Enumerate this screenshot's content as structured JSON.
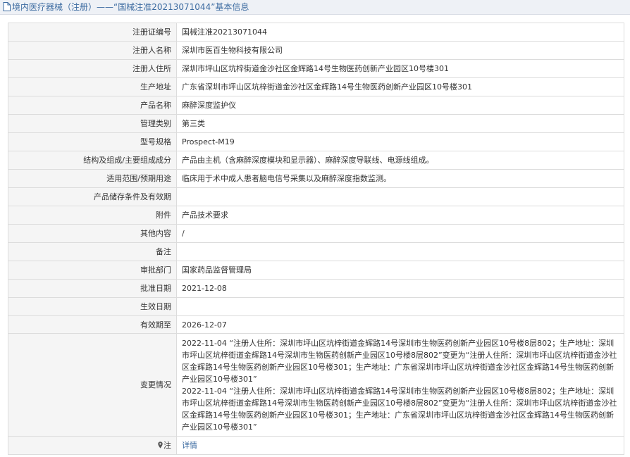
{
  "breadcrumb": {
    "icon": "document-icon",
    "text": "境内医疗器械（注册）——“国械注准20213071044”基本信息"
  },
  "rows": [
    {
      "label": "注册证编号",
      "value": "国械注准20213071044"
    },
    {
      "label": "注册人名称",
      "value": "深圳市医百生物科技有限公司"
    },
    {
      "label": "注册人住所",
      "value": "深圳市坪山区坑梓街道金沙社区金辉路14号生物医药创新产业园区10号楼301"
    },
    {
      "label": "生产地址",
      "value": "广东省深圳市坪山区坑梓街道金沙社区金辉路14号生物医药创新产业园区10号楼301"
    },
    {
      "label": "产品名称",
      "value": "麻醉深度监护仪"
    },
    {
      "label": "管理类别",
      "value": "第三类"
    },
    {
      "label": "型号规格",
      "value": "Prospect-M19"
    },
    {
      "label": "结构及组成/主要组成成分",
      "value": "产品由主机（含麻醉深度模块和显示器）、麻醉深度导联线、电源线组成。"
    },
    {
      "label": "适用范围/预期用途",
      "value": "临床用于术中成人患者脑电信号采集以及麻醉深度指数监测。"
    },
    {
      "label": "产品储存条件及有效期",
      "value": ""
    },
    {
      "label": "附件",
      "value": "产品技术要求"
    },
    {
      "label": "其他内容",
      "value": "/"
    },
    {
      "label": "备注",
      "value": ""
    },
    {
      "label": "审批部门",
      "value": "国家药品监督管理局"
    },
    {
      "label": "批准日期",
      "value": "2021-12-08"
    },
    {
      "label": "生效日期",
      "value": ""
    },
    {
      "label": "有效期至",
      "value": "2026-12-07"
    }
  ],
  "changes": {
    "label": "变更情况",
    "entries": [
      "2022-11-04 “注册人住所：深圳市坪山区坑梓街道金辉路14号深圳市生物医药创新产业园区10号楼8层802；生产地址：深圳市坪山区坑梓街道金辉路14号深圳市生物医药创新产业园区10号楼8层802”变更为“注册人住所：深圳市坪山区坑梓街道金沙社区金辉路14号生物医药创新产业园区10号楼301；生产地址：广东省深圳市坪山区坑梓街道金沙社区金辉路14号生物医药创新产业园区10号楼301”",
      "2022-11-04 “注册人住所：深圳市坪山区坑梓街道金辉路14号深圳市生物医药创新产业园区10号楼8层802；生产地址：深圳市坪山区坑梓街道金辉路14号深圳市生物医药创新产业园区10号楼8层802”变更为“注册人住所：深圳市坪山区坑梓街道金沙社区金辉路14号生物医药创新产业园区10号楼301；生产地址：广东省深圳市坪山区坑梓街道金沙社区金辉路14号生物医药创新产业园区10号楼301”"
    ]
  },
  "note": {
    "icon": "map-pin-icon",
    "label": "注",
    "link_text": "详情"
  },
  "colors": {
    "link": "#3b6aa0",
    "label_bg": "#f5f5f5",
    "border": "#dcdcdc",
    "header_bg": "#eef1f6"
  }
}
